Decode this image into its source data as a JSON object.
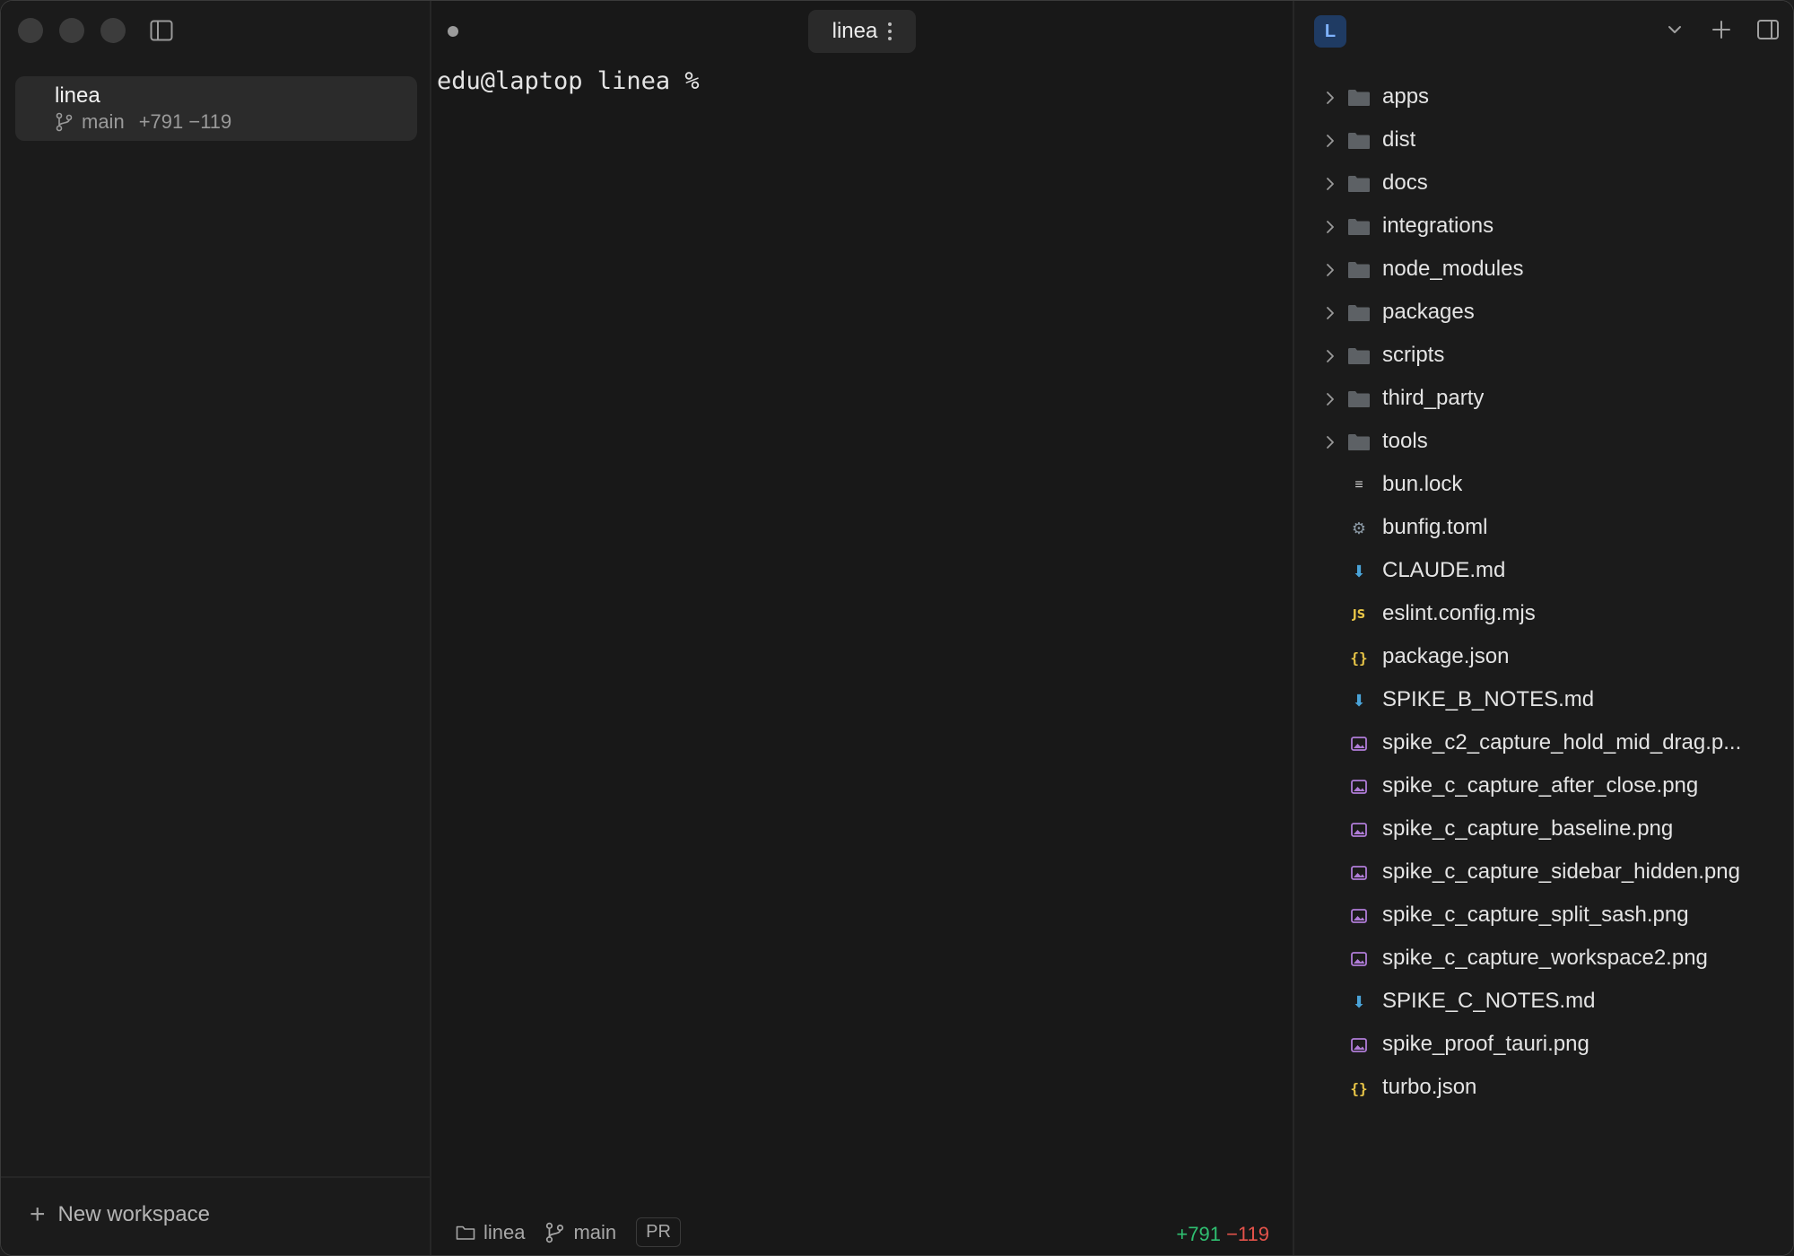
{
  "sidebar": {
    "workspace": {
      "name": "linea",
      "branch": "main",
      "diff": "+791 −119"
    },
    "new_workspace_label": "New workspace"
  },
  "terminal": {
    "tab_label": "linea",
    "prompt": "edu@laptop linea %"
  },
  "statusbar": {
    "folder": "linea",
    "branch": "main",
    "pr_label": "PR",
    "additions": "+791",
    "deletions": "−119"
  },
  "rightpanel": {
    "avatar_letter": "L",
    "files": [
      {
        "name": "apps",
        "type": "folder",
        "icon": "folder-icon"
      },
      {
        "name": "dist",
        "type": "folder",
        "icon": "folder-icon"
      },
      {
        "name": "docs",
        "type": "folder",
        "icon": "folder-icon"
      },
      {
        "name": "integrations",
        "type": "folder",
        "icon": "folder-icon"
      },
      {
        "name": "node_modules",
        "type": "folder",
        "icon": "folder-icon"
      },
      {
        "name": "packages",
        "type": "folder",
        "icon": "folder-icon"
      },
      {
        "name": "scripts",
        "type": "folder",
        "icon": "folder-icon"
      },
      {
        "name": "third_party",
        "type": "folder",
        "icon": "folder-icon"
      },
      {
        "name": "tools",
        "type": "folder",
        "icon": "folder-icon"
      },
      {
        "name": "bun.lock",
        "type": "file",
        "icon": "text-file-icon"
      },
      {
        "name": "bunfig.toml",
        "type": "file",
        "icon": "gear-icon"
      },
      {
        "name": "CLAUDE.md",
        "type": "file",
        "icon": "markdown-icon"
      },
      {
        "name": "eslint.config.mjs",
        "type": "file",
        "icon": "js-icon"
      },
      {
        "name": "package.json",
        "type": "file",
        "icon": "json-icon"
      },
      {
        "name": "SPIKE_B_NOTES.md",
        "type": "file",
        "icon": "markdown-icon"
      },
      {
        "name": "spike_c2_capture_hold_mid_drag.p...",
        "type": "file",
        "icon": "image-icon"
      },
      {
        "name": "spike_c_capture_after_close.png",
        "type": "file",
        "icon": "image-icon"
      },
      {
        "name": "spike_c_capture_baseline.png",
        "type": "file",
        "icon": "image-icon"
      },
      {
        "name": "spike_c_capture_sidebar_hidden.png",
        "type": "file",
        "icon": "image-icon"
      },
      {
        "name": "spike_c_capture_split_sash.png",
        "type": "file",
        "icon": "image-icon"
      },
      {
        "name": "spike_c_capture_workspace2.png",
        "type": "file",
        "icon": "image-icon"
      },
      {
        "name": "SPIKE_C_NOTES.md",
        "type": "file",
        "icon": "markdown-icon"
      },
      {
        "name": "spike_proof_tauri.png",
        "type": "file",
        "icon": "image-icon"
      },
      {
        "name": "turbo.json",
        "type": "file",
        "icon": "json-icon"
      }
    ]
  },
  "colors": {
    "background": "#181818",
    "additions": "#2fbf71",
    "deletions": "#e5534b",
    "image_icon": "#b07cd8",
    "markdown_icon": "#4aa3d8",
    "js_icon": "#e8c547"
  }
}
